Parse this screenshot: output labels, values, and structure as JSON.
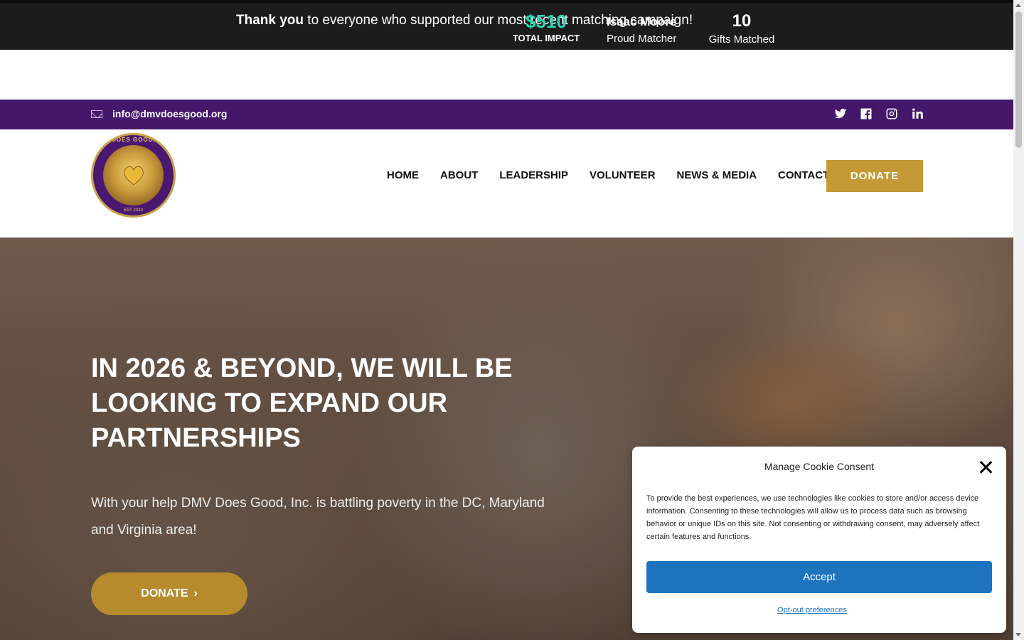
{
  "banner": {
    "thanks_bold": "Thank you",
    "thanks_rest": " to everyone who supported our most recent matching campaign!",
    "impact_value": "$510",
    "impact_label": "TOTAL IMPACT",
    "matcher_name": "Isaac Moore",
    "matcher_label": "Proud Matcher",
    "gifts_value": "10",
    "gifts_label": "Gifts Matched"
  },
  "topbar": {
    "email": "info@dmvdoesgood.org",
    "socials": [
      "twitter-icon",
      "facebook-icon",
      "instagram-icon",
      "linkedin-icon"
    ]
  },
  "logo": {
    "text": "DMV DOES GOOD, INC.",
    "est": "EST 2020"
  },
  "nav": {
    "items": [
      "HOME",
      "ABOUT",
      "LEADERSHIP",
      "VOLUNTEER",
      "NEWS & MEDIA",
      "CONTACT"
    ],
    "donate": "DONATE"
  },
  "hero": {
    "title": "In 2026 & beyond, we will be looking to expand our partnerships",
    "subtitle": "With your help DMV Does Good, Inc. is battling poverty in the DC, Maryland and Virginia area!",
    "button": "DONATE"
  },
  "cookie": {
    "title": "Manage Cookie Consent",
    "text": "To provide the best experiences, we use technologies like cookies to store and/or access device information. Consenting to these technologies will allow us to process data such as browsing behavior or unique IDs on this site. Not consenting or withdrawing consent, may adversely affect certain features and functions.",
    "accept": "Accept",
    "opt_out": "Opt-out preferences"
  },
  "colors": {
    "purple": "#44176b",
    "gold": "#c49a36",
    "teal": "#2dd4b4",
    "accept_blue": "#1e73be"
  }
}
